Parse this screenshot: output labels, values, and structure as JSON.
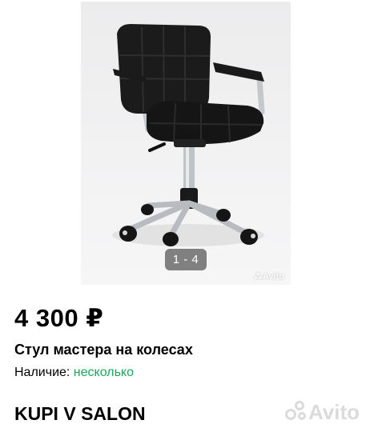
{
  "gallery": {
    "counter": "1 - 4",
    "watermark_small": "Avito"
  },
  "listing": {
    "price": "4 300 ₽",
    "title": "Стул мастера на колесах",
    "availability_label": "Наличие:",
    "availability_value": "несколько",
    "seller": "KUPI V SALON"
  },
  "watermark": {
    "text": "Avito"
  },
  "colors": {
    "availability_value": "#19a85b"
  }
}
